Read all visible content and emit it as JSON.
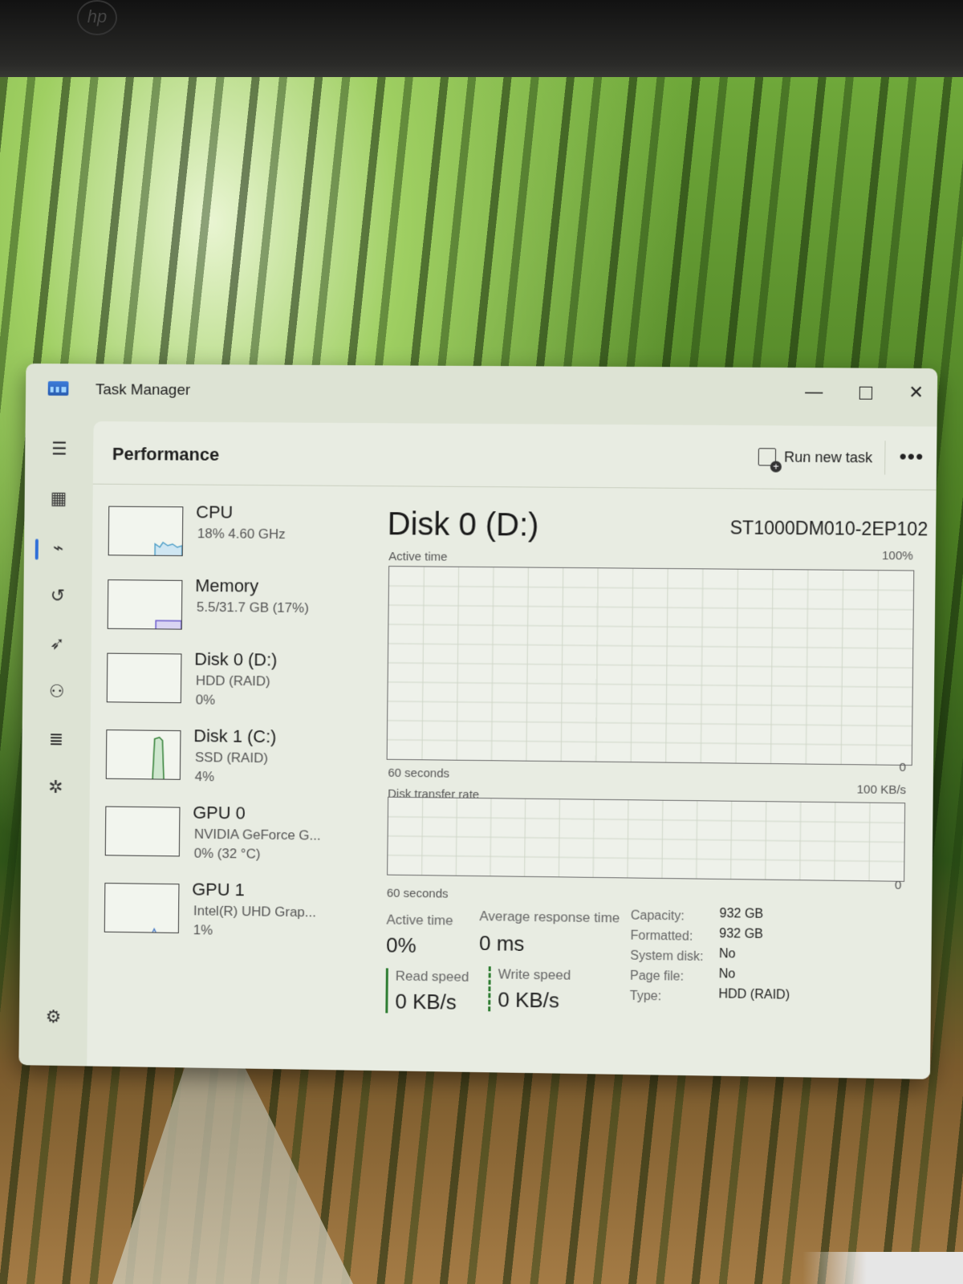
{
  "window": {
    "title": "Task Manager"
  },
  "nav": {
    "items": [
      {
        "name": "hamburger-icon",
        "glyph": "☰"
      },
      {
        "name": "processes-icon",
        "glyph": "▦"
      },
      {
        "name": "performance-icon",
        "glyph": "⌁"
      },
      {
        "name": "app-history-icon",
        "glyph": "↺"
      },
      {
        "name": "startup-apps-icon",
        "glyph": "➶"
      },
      {
        "name": "users-icon",
        "glyph": "⚇"
      },
      {
        "name": "details-icon",
        "glyph": "≣"
      },
      {
        "name": "services-icon",
        "glyph": "✲"
      }
    ],
    "settings_glyph": "⚙"
  },
  "header": {
    "page_title": "Performance",
    "run_new_task": "Run new task",
    "more": "•••"
  },
  "devices": [
    {
      "name": "CPU",
      "line1": "18% 4.60 GHz",
      "line2": ""
    },
    {
      "name": "Memory",
      "line1": "5.5/31.7 GB (17%)",
      "line2": ""
    },
    {
      "name": "Disk 0 (D:)",
      "line1": "HDD (RAID)",
      "line2": "0%"
    },
    {
      "name": "Disk 1 (C:)",
      "line1": "SSD (RAID)",
      "line2": "4%"
    },
    {
      "name": "GPU 0",
      "line1": "NVIDIA GeForce G...",
      "line2": "0% (32 °C)"
    },
    {
      "name": "GPU 1",
      "line1": "Intel(R) UHD Grap...",
      "line2": "1%"
    }
  ],
  "detail": {
    "title": "Disk 0 (D:)",
    "model": "ST1000DM010-2EP102",
    "active_time_chart": {
      "label": "Active time",
      "max": "100%",
      "min": "0",
      "span": "60 seconds"
    },
    "transfer_chart": {
      "label": "Disk transfer rate",
      "max": "100 KB/s",
      "min": "0",
      "span": "60 seconds"
    },
    "stats": {
      "active_time_label": "Active time",
      "active_time_value": "0%",
      "avg_response_label": "Average response time",
      "avg_response_value": "0 ms",
      "read_label": "Read speed",
      "read_value": "0 KB/s",
      "write_label": "Write speed",
      "write_value": "0 KB/s"
    },
    "properties": [
      {
        "key": "Capacity:",
        "value": "932 GB"
      },
      {
        "key": "Formatted:",
        "value": "932 GB"
      },
      {
        "key": "System disk:",
        "value": "No"
      },
      {
        "key": "Page file:",
        "value": "No"
      },
      {
        "key": "Type:",
        "value": "HDD (RAID)"
      }
    ]
  },
  "colors": {
    "accent": "#2f6fd8",
    "disk_green": "#2e7d32",
    "cpu_blue": "#4f9fc8",
    "memory_purple": "#6a5acd"
  }
}
